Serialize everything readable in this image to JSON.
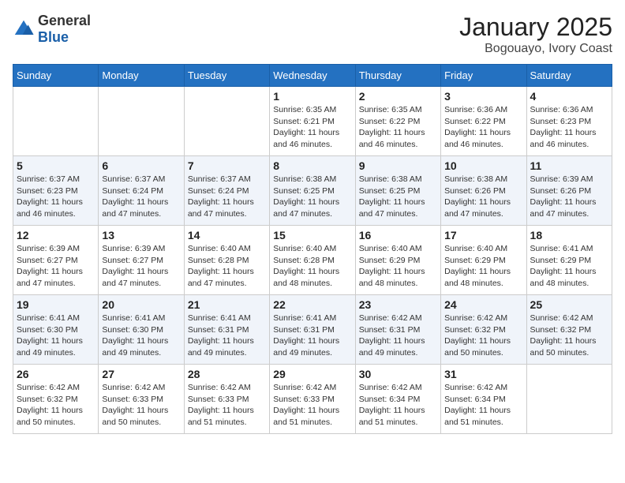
{
  "header": {
    "logo": {
      "general": "General",
      "blue": "Blue"
    },
    "title": "January 2025",
    "subtitle": "Bogouayo, Ivory Coast"
  },
  "weekdays": [
    "Sunday",
    "Monday",
    "Tuesday",
    "Wednesday",
    "Thursday",
    "Friday",
    "Saturday"
  ],
  "weeks": [
    [
      {
        "day": "",
        "sunrise": "",
        "sunset": "",
        "daylight": ""
      },
      {
        "day": "",
        "sunrise": "",
        "sunset": "",
        "daylight": ""
      },
      {
        "day": "",
        "sunrise": "",
        "sunset": "",
        "daylight": ""
      },
      {
        "day": "1",
        "sunrise": "Sunrise: 6:35 AM",
        "sunset": "Sunset: 6:21 PM",
        "daylight": "Daylight: 11 hours and 46 minutes."
      },
      {
        "day": "2",
        "sunrise": "Sunrise: 6:35 AM",
        "sunset": "Sunset: 6:22 PM",
        "daylight": "Daylight: 11 hours and 46 minutes."
      },
      {
        "day": "3",
        "sunrise": "Sunrise: 6:36 AM",
        "sunset": "Sunset: 6:22 PM",
        "daylight": "Daylight: 11 hours and 46 minutes."
      },
      {
        "day": "4",
        "sunrise": "Sunrise: 6:36 AM",
        "sunset": "Sunset: 6:23 PM",
        "daylight": "Daylight: 11 hours and 46 minutes."
      }
    ],
    [
      {
        "day": "5",
        "sunrise": "Sunrise: 6:37 AM",
        "sunset": "Sunset: 6:23 PM",
        "daylight": "Daylight: 11 hours and 46 minutes."
      },
      {
        "day": "6",
        "sunrise": "Sunrise: 6:37 AM",
        "sunset": "Sunset: 6:24 PM",
        "daylight": "Daylight: 11 hours and 47 minutes."
      },
      {
        "day": "7",
        "sunrise": "Sunrise: 6:37 AM",
        "sunset": "Sunset: 6:24 PM",
        "daylight": "Daylight: 11 hours and 47 minutes."
      },
      {
        "day": "8",
        "sunrise": "Sunrise: 6:38 AM",
        "sunset": "Sunset: 6:25 PM",
        "daylight": "Daylight: 11 hours and 47 minutes."
      },
      {
        "day": "9",
        "sunrise": "Sunrise: 6:38 AM",
        "sunset": "Sunset: 6:25 PM",
        "daylight": "Daylight: 11 hours and 47 minutes."
      },
      {
        "day": "10",
        "sunrise": "Sunrise: 6:38 AM",
        "sunset": "Sunset: 6:26 PM",
        "daylight": "Daylight: 11 hours and 47 minutes."
      },
      {
        "day": "11",
        "sunrise": "Sunrise: 6:39 AM",
        "sunset": "Sunset: 6:26 PM",
        "daylight": "Daylight: 11 hours and 47 minutes."
      }
    ],
    [
      {
        "day": "12",
        "sunrise": "Sunrise: 6:39 AM",
        "sunset": "Sunset: 6:27 PM",
        "daylight": "Daylight: 11 hours and 47 minutes."
      },
      {
        "day": "13",
        "sunrise": "Sunrise: 6:39 AM",
        "sunset": "Sunset: 6:27 PM",
        "daylight": "Daylight: 11 hours and 47 minutes."
      },
      {
        "day": "14",
        "sunrise": "Sunrise: 6:40 AM",
        "sunset": "Sunset: 6:28 PM",
        "daylight": "Daylight: 11 hours and 47 minutes."
      },
      {
        "day": "15",
        "sunrise": "Sunrise: 6:40 AM",
        "sunset": "Sunset: 6:28 PM",
        "daylight": "Daylight: 11 hours and 48 minutes."
      },
      {
        "day": "16",
        "sunrise": "Sunrise: 6:40 AM",
        "sunset": "Sunset: 6:29 PM",
        "daylight": "Daylight: 11 hours and 48 minutes."
      },
      {
        "day": "17",
        "sunrise": "Sunrise: 6:40 AM",
        "sunset": "Sunset: 6:29 PM",
        "daylight": "Daylight: 11 hours and 48 minutes."
      },
      {
        "day": "18",
        "sunrise": "Sunrise: 6:41 AM",
        "sunset": "Sunset: 6:29 PM",
        "daylight": "Daylight: 11 hours and 48 minutes."
      }
    ],
    [
      {
        "day": "19",
        "sunrise": "Sunrise: 6:41 AM",
        "sunset": "Sunset: 6:30 PM",
        "daylight": "Daylight: 11 hours and 49 minutes."
      },
      {
        "day": "20",
        "sunrise": "Sunrise: 6:41 AM",
        "sunset": "Sunset: 6:30 PM",
        "daylight": "Daylight: 11 hours and 49 minutes."
      },
      {
        "day": "21",
        "sunrise": "Sunrise: 6:41 AM",
        "sunset": "Sunset: 6:31 PM",
        "daylight": "Daylight: 11 hours and 49 minutes."
      },
      {
        "day": "22",
        "sunrise": "Sunrise: 6:41 AM",
        "sunset": "Sunset: 6:31 PM",
        "daylight": "Daylight: 11 hours and 49 minutes."
      },
      {
        "day": "23",
        "sunrise": "Sunrise: 6:42 AM",
        "sunset": "Sunset: 6:31 PM",
        "daylight": "Daylight: 11 hours and 49 minutes."
      },
      {
        "day": "24",
        "sunrise": "Sunrise: 6:42 AM",
        "sunset": "Sunset: 6:32 PM",
        "daylight": "Daylight: 11 hours and 50 minutes."
      },
      {
        "day": "25",
        "sunrise": "Sunrise: 6:42 AM",
        "sunset": "Sunset: 6:32 PM",
        "daylight": "Daylight: 11 hours and 50 minutes."
      }
    ],
    [
      {
        "day": "26",
        "sunrise": "Sunrise: 6:42 AM",
        "sunset": "Sunset: 6:32 PM",
        "daylight": "Daylight: 11 hours and 50 minutes."
      },
      {
        "day": "27",
        "sunrise": "Sunrise: 6:42 AM",
        "sunset": "Sunset: 6:33 PM",
        "daylight": "Daylight: 11 hours and 50 minutes."
      },
      {
        "day": "28",
        "sunrise": "Sunrise: 6:42 AM",
        "sunset": "Sunset: 6:33 PM",
        "daylight": "Daylight: 11 hours and 51 minutes."
      },
      {
        "day": "29",
        "sunrise": "Sunrise: 6:42 AM",
        "sunset": "Sunset: 6:33 PM",
        "daylight": "Daylight: 11 hours and 51 minutes."
      },
      {
        "day": "30",
        "sunrise": "Sunrise: 6:42 AM",
        "sunset": "Sunset: 6:34 PM",
        "daylight": "Daylight: 11 hours and 51 minutes."
      },
      {
        "day": "31",
        "sunrise": "Sunrise: 6:42 AM",
        "sunset": "Sunset: 6:34 PM",
        "daylight": "Daylight: 11 hours and 51 minutes."
      },
      {
        "day": "",
        "sunrise": "",
        "sunset": "",
        "daylight": ""
      }
    ]
  ]
}
